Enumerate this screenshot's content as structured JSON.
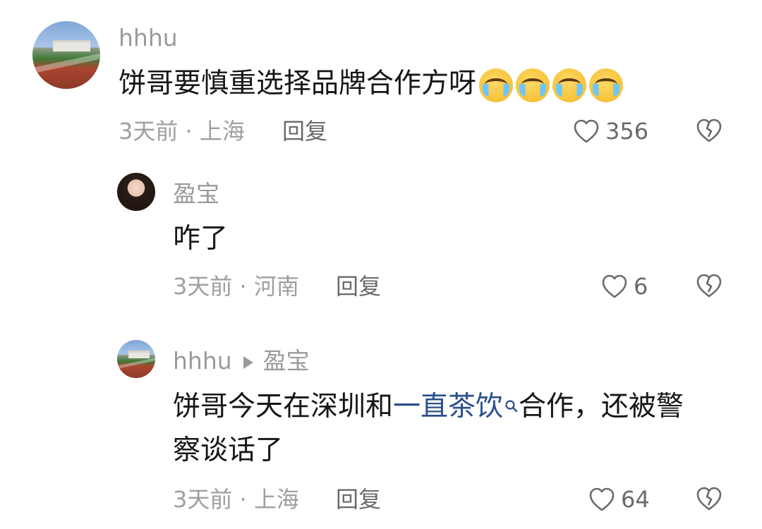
{
  "comments": [
    {
      "username": "hhhu",
      "text": "饼哥要慎重选择品牌合作方呀",
      "emoji_count": 4,
      "emoji_name": "crying-face-emoji",
      "time_location": "3天前 · 上海",
      "reply_label": "回复",
      "like_count": "356"
    },
    {
      "username": "盈宝",
      "text": "咋了",
      "time_location": "3天前 · 河南",
      "reply_label": "回复",
      "like_count": "6"
    },
    {
      "username": "hhhu",
      "reply_to": "盈宝",
      "text_before": "饼哥今天在深圳和",
      "link_text": "一直茶饮",
      "text_after": "合作，还被警",
      "text_line2": "察谈话了",
      "time_location": "3天前 · 上海",
      "reply_label": "回复",
      "like_count": "64"
    }
  ],
  "colors": {
    "link": "#28508c",
    "meta": "#9f9f9f",
    "text": "#161616"
  },
  "icons": [
    "heart-outline-icon",
    "broken-heart-icon",
    "search-small-icon",
    "reply-arrow-icon"
  ]
}
